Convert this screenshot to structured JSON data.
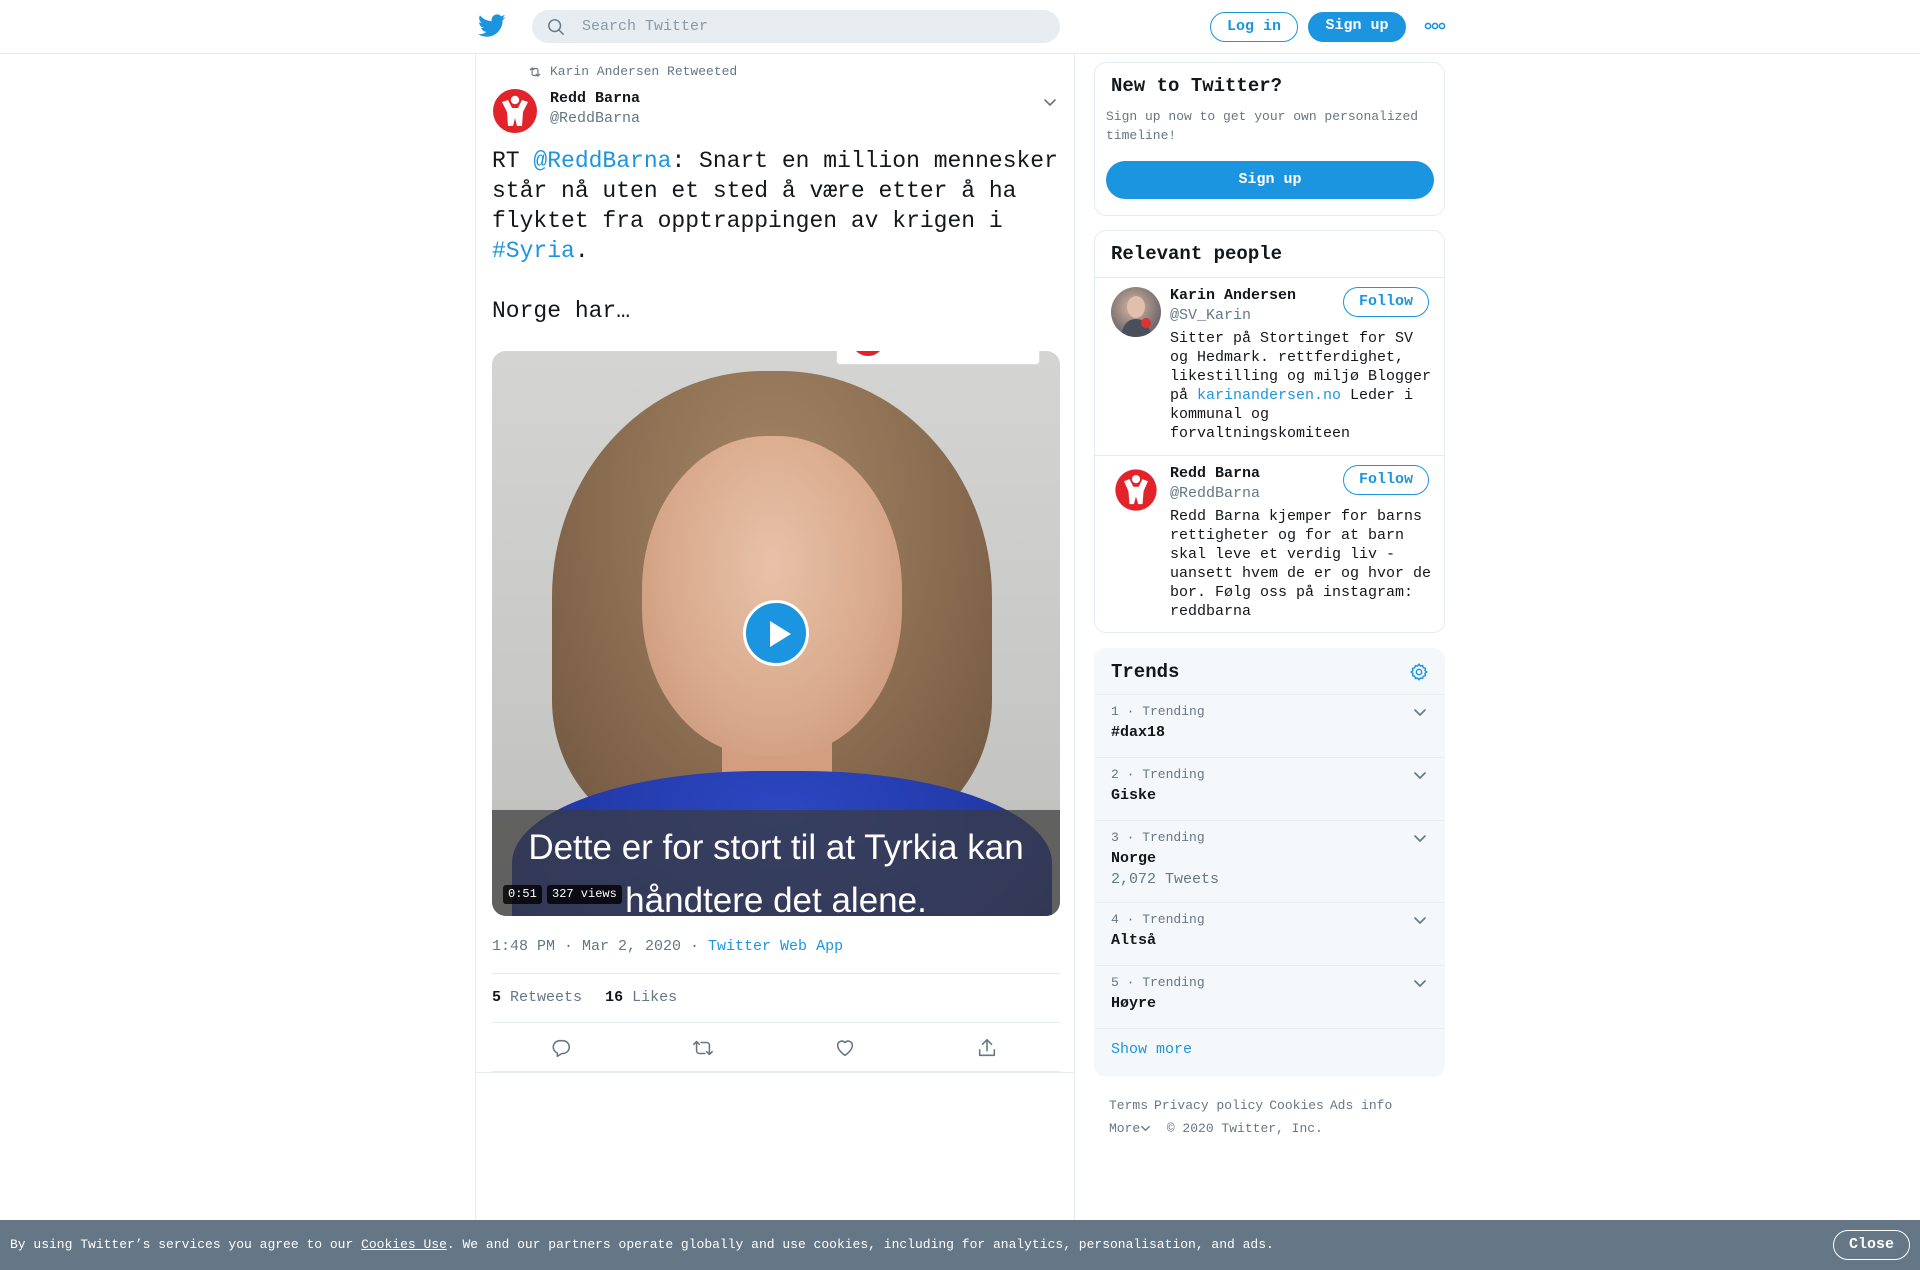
{
  "header": {
    "search_placeholder": "Search Twitter",
    "login_label": "Log in",
    "signup_label": "Sign up",
    "more_icon": "ellipsis-icon",
    "logo_icon": "twitter-bird-icon"
  },
  "tweet": {
    "retweet_context": "Karin Andersen Retweeted",
    "author_name": "Redd Barna",
    "author_handle": "@ReddBarna",
    "text_prefix": "RT ",
    "text_mention": "@ReddBarna",
    "text_middle": ": Snart en million mennesker står nå uten et sted å være etter å ha flyktet fra opptrappingen av krigen i ",
    "text_hashtag": "#Syria",
    "text_suffix": ".\n\nNorge har…",
    "video_subtitle": "Dette er for stort til at Tyrkia kan\nhåndtere det alene.",
    "video_duration": "0:51",
    "video_views": "327 views",
    "timestamp": "1:48 PM · Mar 2, 2020 · ",
    "source": "Twitter Web App",
    "retweets_count": "5",
    "retweets_label": "Retweets",
    "likes_count": "16",
    "likes_label": "Likes"
  },
  "sidebar": {
    "new_to_twitter": {
      "title": "New to Twitter?",
      "text": "Sign up now to get your own personalized timeline!",
      "button": "Sign up"
    },
    "relevant_people": {
      "title": "Relevant people",
      "people": [
        {
          "name": "Karin Andersen",
          "handle": "@SV_Karin",
          "follow": "Follow",
          "bio_text": "Sitter på Stortinget for SV og Hedmark. rettferdighet, likestilling og miljø Blogger på ",
          "bio_link": "karinandersen.no",
          "bio_text2": " Leder i kommunal og forvaltningskomiteen"
        },
        {
          "name": "Redd Barna",
          "handle": "@ReddBarna",
          "follow": "Follow",
          "bio_text": "Redd Barna kjemper for barns rettigheter og for at barn skal leve et verdig liv - uansett hvem de er og hvor de bor. Følg oss på instagram: reddbarna"
        }
      ]
    },
    "trends": {
      "title": "Trends",
      "items": [
        {
          "meta": "1 · Trending",
          "name": "#dax18",
          "count": ""
        },
        {
          "meta": "2 · Trending",
          "name": "Giske",
          "count": ""
        },
        {
          "meta": "3 · Trending",
          "name": "Norge",
          "count": "2,072 Tweets"
        },
        {
          "meta": "4 · Trending",
          "name": "Altså",
          "count": ""
        },
        {
          "meta": "5 · Trending",
          "name": "Høyre",
          "count": ""
        }
      ],
      "show_more": "Show more"
    },
    "footer": {
      "terms": "Terms",
      "privacy": "Privacy policy",
      "cookies": "Cookies",
      "ads": "Ads info",
      "more": "More",
      "copyright": "© 2020 Twitter, Inc."
    }
  },
  "cookie_bar": {
    "text_before": "By using Twitter’s services you agree to our ",
    "link": "Cookies Use",
    "text_after": ". We and our partners operate globally and use cookies, including for analytics, personalisation, and ads.",
    "close": "Close"
  },
  "colors": {
    "accent": "#1b95e0",
    "muted": "#657786",
    "brand_red": "#e2232a"
  }
}
